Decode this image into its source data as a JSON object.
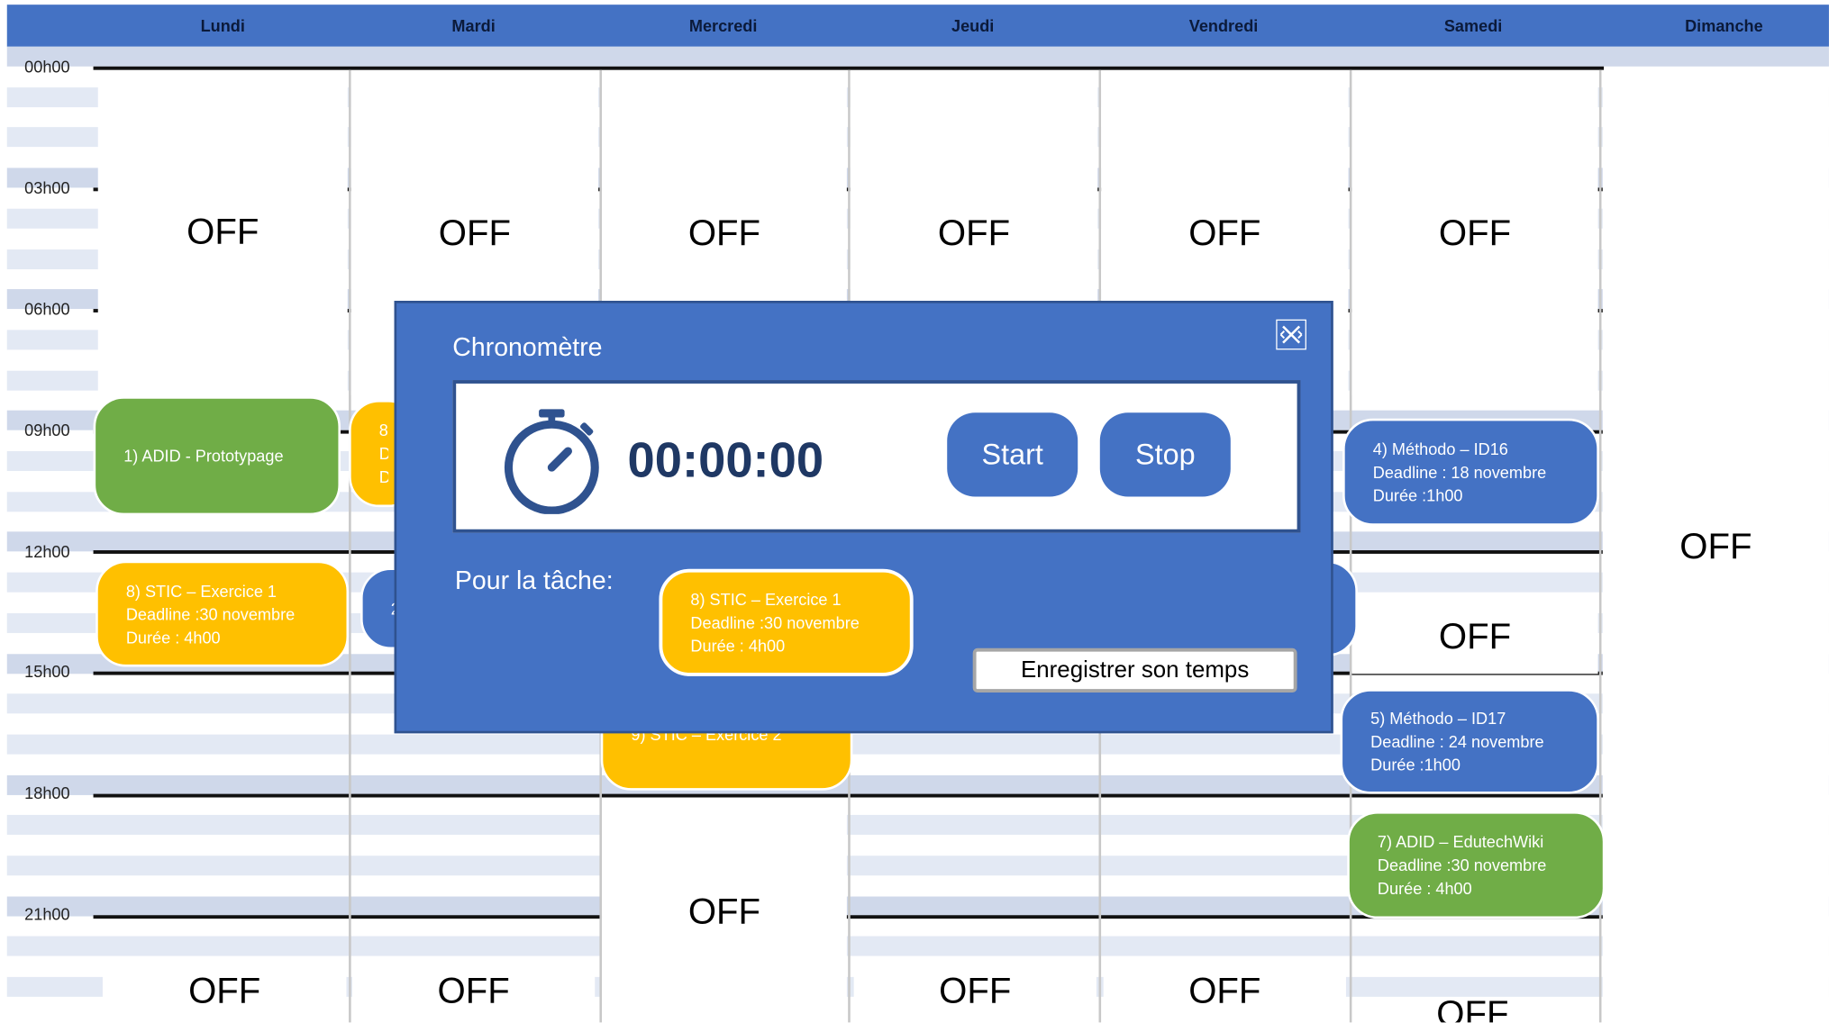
{
  "days": [
    "Lundi",
    "Mardi",
    "Mercredi",
    "Jeudi",
    "Vendredi",
    "Samedi",
    "Dimanche"
  ],
  "hours": [
    "00h00",
    "03h00",
    "06h00",
    "09h00",
    "12h00",
    "15h00",
    "18h00",
    "21h00"
  ],
  "off_label": "OFF",
  "tasks": {
    "adid_proto": {
      "line1": "1)  ADID  - Prototypage"
    },
    "stic_ex1": {
      "line1": "8)  STIC – Exercice 1",
      "line2": "Deadline :30 novembre",
      "line3": "Durée : 4h00"
    },
    "mardi_partial": {
      "line1": "8)",
      "line2": "De",
      "line3": "Du"
    },
    "mardi_blue_partial": {
      "line1": "2"
    },
    "stic_ex2": {
      "line1": "9)  STIC – Exercice 2"
    },
    "methodo_id16": {
      "line1": "4)  Méthodo – ID16",
      "line2": "Deadline : 18 novembre",
      "line3": "Durée :1h00"
    },
    "methodo_id17": {
      "line1": "5)  Méthodo – ID17",
      "line2": "Deadline : 24 novembre",
      "line3": "Durée :1h00"
    },
    "adid_edutech": {
      "line1": "7)  ADID – EdutechWiki",
      "line2": "Deadline :30 novembre",
      "line3": "Durée : 4h00"
    }
  },
  "modal": {
    "title": "Chronomètre",
    "time": "00:00:00",
    "start_label": "Start",
    "stop_label": "Stop",
    "for_task_label": "Pour la tâche:",
    "save_label": "Enregistrer son temps",
    "task": {
      "line1": "8)  STIC – Exercice 1",
      "line2": "Deadline :30 novembre",
      "line3": "Durée : 4h00"
    }
  },
  "colors": {
    "header": "#4472c4",
    "green": "#70ad47",
    "yellow": "#ffc000",
    "blue": "#4472c4",
    "band": "#cfd8ea"
  },
  "icons": {
    "timer": "stopwatch-icon",
    "close": "close-icon"
  }
}
